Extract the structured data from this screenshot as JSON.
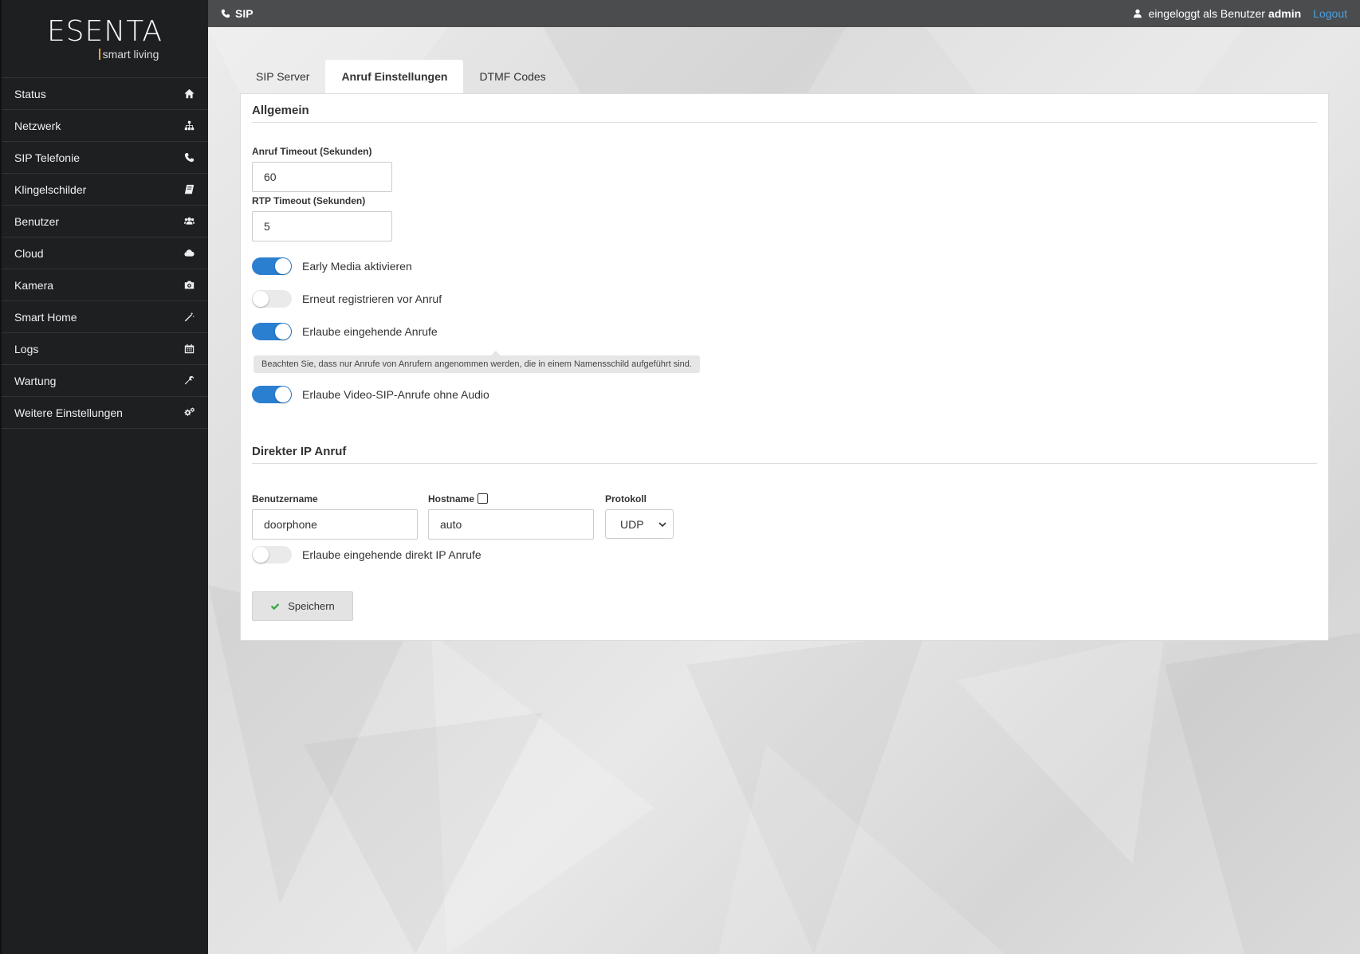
{
  "logo": {
    "brand": "ESENTA",
    "tagline": "smart living"
  },
  "sidebar": {
    "items": [
      {
        "label": "Status",
        "icon": "home-icon"
      },
      {
        "label": "Netzwerk",
        "icon": "sitemap-icon"
      },
      {
        "label": "SIP Telefonie",
        "icon": "phone-icon"
      },
      {
        "label": "Klingelschilder",
        "icon": "book-icon"
      },
      {
        "label": "Benutzer",
        "icon": "users-icon"
      },
      {
        "label": "Cloud",
        "icon": "cloud-icon"
      },
      {
        "label": "Kamera",
        "icon": "camera-icon"
      },
      {
        "label": "Smart Home",
        "icon": "magic-wand-icon"
      },
      {
        "label": "Logs",
        "icon": "calendar-icon"
      },
      {
        "label": "Wartung",
        "icon": "wrench-icon"
      },
      {
        "label": "Weitere Einstellungen",
        "icon": "gears-icon"
      }
    ]
  },
  "header": {
    "title": "SIP",
    "logged_in_text": "eingeloggt als Benutzer",
    "username": "admin",
    "logout": "Logout"
  },
  "tabs": [
    {
      "label": "SIP Server",
      "active": false
    },
    {
      "label": "Anruf Einstellungen",
      "active": true
    },
    {
      "label": "DTMF Codes",
      "active": false
    }
  ],
  "general": {
    "title": "Allgemein",
    "call_timeout_label": "Anruf Timeout (Sekunden)",
    "call_timeout_value": "60",
    "rtp_timeout_label": "RTP Timeout (Sekunden)",
    "rtp_timeout_value": "5",
    "toggles": [
      {
        "label": "Early Media aktivieren",
        "on": true
      },
      {
        "label": "Erneut registrieren vor Anruf",
        "on": false
      },
      {
        "label": "Erlaube eingehende Anrufe",
        "on": true
      },
      {
        "label": "Erlaube Video-SIP-Anrufe ohne Audio",
        "on": true
      }
    ],
    "hint": "Beachten Sie, dass nur Anrufe von Anrufern angenommen werden, die in einem Namensschild aufgeführt sind."
  },
  "direct_ip": {
    "title": "Direkter IP Anruf",
    "username_label": "Benutzername",
    "username_value": "doorphone",
    "hostname_label": "Hostname",
    "hostname_checked": false,
    "hostname_value": "auto",
    "protocol_label": "Protokoll",
    "protocol_value": "UDP",
    "toggle_label": "Erlaube eingehende direkt IP Anrufe",
    "toggle_on": false
  },
  "save_button": "Speichern",
  "colors": {
    "accent": "#2b7fd0",
    "sidebar": "#1e1f21",
    "topbar": "#4b4c4e",
    "link": "#4a9fe0",
    "check": "#3aa84a"
  }
}
